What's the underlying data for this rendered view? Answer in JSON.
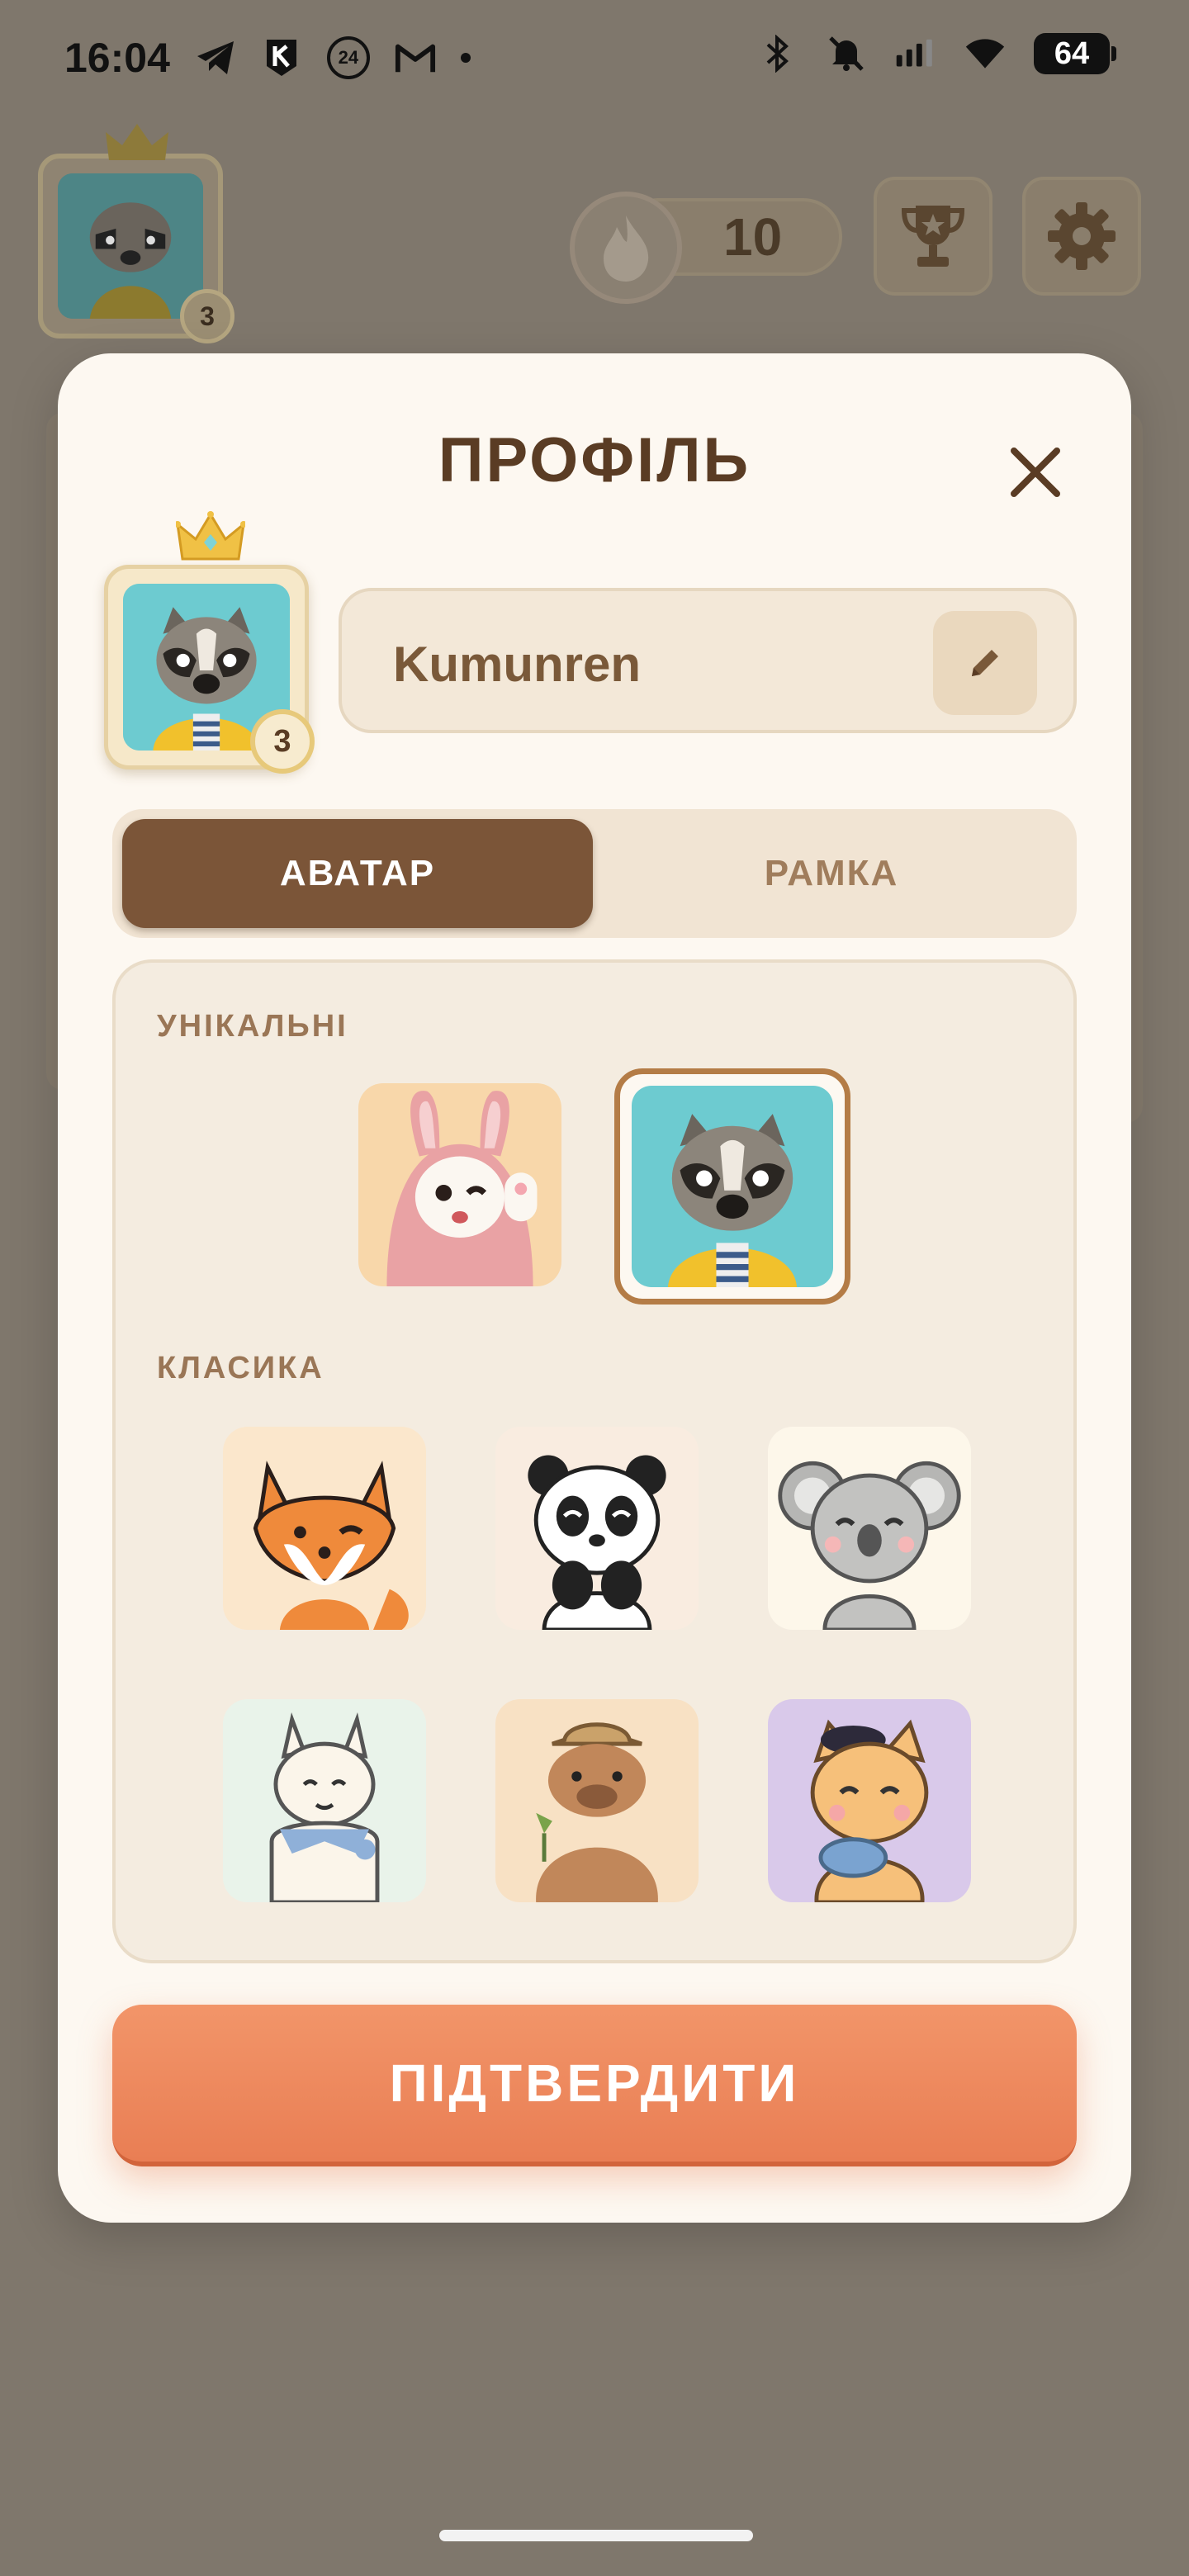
{
  "status_bar": {
    "time": "16:04",
    "badge_24": "24",
    "battery": "64",
    "left_icons": [
      "telegram-icon",
      "kyivstar-icon",
      "24-channel-icon",
      "gmail-icon",
      "more-dot-icon"
    ],
    "right_icons": [
      "bluetooth-icon",
      "mute-icon",
      "signal-icon",
      "wifi-icon",
      "battery-icon"
    ]
  },
  "background": {
    "avatar_level": "3",
    "streak_count": "10"
  },
  "modal": {
    "title": "ПРОФІЛЬ",
    "avatar_level": "3",
    "username": "Kumunren",
    "tabs": [
      {
        "label": "АВАТАР",
        "active": true
      },
      {
        "label": "РАМКА",
        "active": false
      }
    ],
    "sections": {
      "unique": {
        "label": "УНІКАЛЬНІ",
        "avatars": [
          "bunny",
          "raccoon"
        ],
        "selected": "raccoon"
      },
      "classic": {
        "label": "КЛАСИКА",
        "avatars": [
          "fox",
          "panda",
          "koala",
          "alpaca",
          "capybara",
          "cat"
        ]
      }
    },
    "confirm_label": "ПІДТВЕРДИТИ"
  },
  "colors": {
    "accent": "#7b5538",
    "confirm": "#ee8a5f",
    "panel": "#fdf8f1",
    "overlay": "#7f776c"
  }
}
